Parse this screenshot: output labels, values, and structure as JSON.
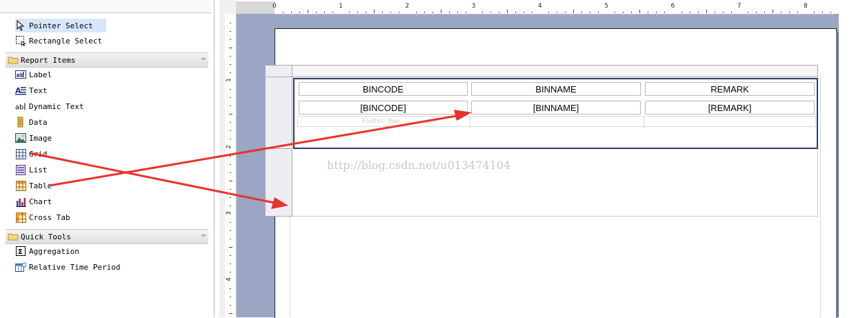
{
  "palette": {
    "pointer_select": "Pointer Select",
    "rectangle_select": "Rectangle Select",
    "report_items_title": "Report Items",
    "report_items": [
      {
        "label": "Label",
        "icon": "label-icon"
      },
      {
        "label": "Text",
        "icon": "text-icon"
      },
      {
        "label": "Dynamic Text",
        "icon": "dynamic-text-icon"
      },
      {
        "label": "Data",
        "icon": "data-icon"
      },
      {
        "label": "Image",
        "icon": "image-icon"
      },
      {
        "label": "Grid",
        "icon": "grid-icon"
      },
      {
        "label": "List",
        "icon": "list-icon"
      },
      {
        "label": "Table",
        "icon": "table-icon"
      },
      {
        "label": "Chart",
        "icon": "chart-icon"
      },
      {
        "label": "Cross Tab",
        "icon": "cross-tab-icon"
      }
    ],
    "quick_tools_title": "Quick Tools",
    "quick_tools": [
      {
        "label": "Aggregation",
        "icon": "sigma-icon"
      },
      {
        "label": "Relative Time Period",
        "icon": "calendar-icon"
      }
    ]
  },
  "ruler": {
    "h_labels": [
      "0",
      "1",
      "2",
      "3",
      "4",
      "5",
      "6",
      "7",
      "8"
    ],
    "v_labels": [
      "1",
      "2",
      "3",
      "4"
    ]
  },
  "table": {
    "headers": [
      "BINCODE",
      "BINNAME",
      "REMARK"
    ],
    "details": [
      "[BINCODE]",
      "[BINNAME]",
      "[REMARK]"
    ],
    "footer_label": "Footer Row"
  },
  "watermark": "http://blog.csdn.net/u013474104",
  "colors": {
    "canvas": "#9aa6c4",
    "selection_border": "#283a66",
    "arrow": "#e8332a"
  }
}
